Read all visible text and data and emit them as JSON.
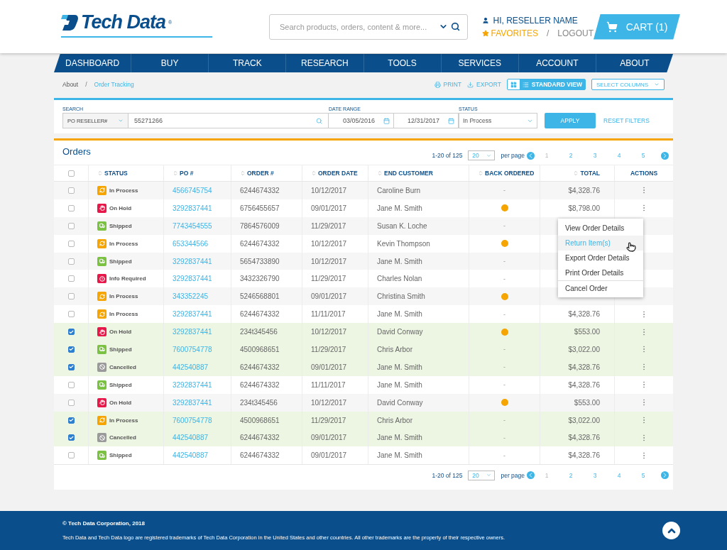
{
  "header": {
    "logo_text": "Tech Data",
    "logo_mark": "®",
    "search": {
      "placeholder": "Search products, orders, content & more..."
    },
    "greeting": "HI, RESELLER NAME",
    "favorites": "FAVORITES",
    "separator": "/",
    "logout": "LOGOUT",
    "cart": "CART (1)"
  },
  "nav": [
    {
      "label": "DASHBOARD",
      "selected": false
    },
    {
      "label": "BUY",
      "selected": false
    },
    {
      "label": "TRACK",
      "selected": false
    },
    {
      "label": "RESEARCH",
      "selected": false
    },
    {
      "label": "TOOLS",
      "selected": false
    },
    {
      "label": "SERVICES",
      "selected": false
    },
    {
      "label": "ACCOUNT",
      "selected": false
    },
    {
      "label": "ABOUT",
      "selected": false
    }
  ],
  "breadcrumb": [
    {
      "label": "About",
      "current": false
    },
    {
      "label": "Order Tracking",
      "current": true
    }
  ],
  "breadcrumb_separator": "/",
  "toolbar": {
    "print": "PRINT",
    "export": "EXPORT",
    "views": [
      {
        "kind": "grid",
        "selected": false
      },
      {
        "kind": "list",
        "label": "STANDARD VIEW",
        "selected": true
      }
    ],
    "select_columns": "SELECT COLUMNS"
  },
  "filters": {
    "search_label": "SEARCH",
    "search_type": "PO RESELLER#",
    "search_value": "55271266",
    "date_label": "DATE RANGE",
    "date_from": "03/05/2016",
    "date_to": "12/31/2017",
    "status_label": "STATUS",
    "status_value": "In Process",
    "apply": "APPLY",
    "reset": "RESET FILTERS"
  },
  "orders": {
    "title": "Orders",
    "pagination_top": {
      "range": "1-20 of 125",
      "per_page": "20",
      "per_page_label": "per page",
      "pages": [
        {
          "label": "1",
          "selected": true
        },
        {
          "label": "2",
          "selected": false
        },
        {
          "label": "3",
          "selected": false
        },
        {
          "label": "4",
          "selected": false
        },
        {
          "label": "5",
          "selected": false
        }
      ]
    },
    "select_all_checked": false,
    "columns": [
      {
        "label": "STATUS",
        "sortable": true
      },
      {
        "label": "PO #",
        "sortable": true
      },
      {
        "label": "ORDER #",
        "sortable": true
      },
      {
        "label": "ORDER DATE",
        "sortable": true
      },
      {
        "label": "END CUSTOMER",
        "sortable": true
      },
      {
        "label": "BACK ORDERED",
        "sortable": true
      },
      {
        "label": "TOTAL",
        "sortable": true
      },
      {
        "label": "ACTIONS",
        "sortable": false
      }
    ],
    "rows": [
      {
        "checked": false,
        "status": {
          "kind": "in_process",
          "label": "In Process"
        },
        "po": "4566745754",
        "order": "6244674332",
        "date": "10/12/2017",
        "customer": "Caroline Burn",
        "back_ordered": false,
        "back_ordered_text": "-",
        "total": "$4,328.76",
        "actions": true
      },
      {
        "checked": false,
        "status": {
          "kind": "on_hold",
          "label": "On Hold"
        },
        "po": "3292837441",
        "order": "6756455657",
        "date": "09/01/2017",
        "customer": "Jane M. Smith",
        "back_ordered": true,
        "total": "$8,798.00",
        "actions": true
      },
      {
        "checked": false,
        "status": {
          "kind": "shipped",
          "label": "Shipped"
        },
        "po": "7743454555",
        "order": "7864576009",
        "date": "11/29/2017",
        "customer": "Susan K. Loche",
        "back_ordered": false,
        "back_ordered_text": "-",
        "actions": false
      },
      {
        "checked": false,
        "status": {
          "kind": "in_process",
          "label": "In Process"
        },
        "po": "653344566",
        "order": "6244674332",
        "date": "10/12/2017",
        "customer": "Kevin Thompson",
        "back_ordered": true,
        "actions": false
      },
      {
        "checked": false,
        "status": {
          "kind": "shipped",
          "label": "Shipped"
        },
        "po": "3292837441",
        "order": "5654733890",
        "date": "10/12/2017",
        "customer": "Jane M. Smith",
        "back_ordered": false,
        "back_ordered_text": "-",
        "actions": false
      },
      {
        "checked": false,
        "status": {
          "kind": "info_required",
          "label": "Info Required"
        },
        "po": "3292837441",
        "order": "3432326790",
        "date": "11/29/2017",
        "customer": "Charles Nolan",
        "back_ordered": false,
        "back_ordered_text": "-",
        "actions": false
      },
      {
        "checked": false,
        "status": {
          "kind": "in_process",
          "label": "In Process"
        },
        "po": "343352245",
        "order": "5246568801",
        "date": "09/01/2017",
        "customer": "Christina Smith",
        "back_ordered": true,
        "actions": false
      },
      {
        "checked": false,
        "status": {
          "kind": "in_process",
          "label": "In Process"
        },
        "po": "3292837441",
        "order": "6244674332",
        "date": "11/11/2017",
        "customer": "Jane M. Smith",
        "back_ordered": false,
        "back_ordered_text": "-",
        "total": "$4,328.76",
        "actions": true
      },
      {
        "checked": true,
        "status": {
          "kind": "on_hold",
          "label": "On Hold"
        },
        "po": "3292837441",
        "order": "234t345456",
        "date": "10/12/2017",
        "customer": "David Conway",
        "back_ordered": true,
        "total": "$553.00",
        "actions": true
      },
      {
        "checked": true,
        "status": {
          "kind": "shipped",
          "label": "Shipped"
        },
        "po": "7600754778",
        "order": "4500968651",
        "date": "11/29/2017",
        "customer": "Chris Arbor",
        "back_ordered": false,
        "back_ordered_text": "-",
        "total": "$3,022.00",
        "actions": true
      },
      {
        "checked": true,
        "status": {
          "kind": "cancelled",
          "label": "Cancelled"
        },
        "po": "442540887",
        "order": "6244674332",
        "date": "09/01/2017",
        "customer": "Jane M. Smith",
        "back_ordered": false,
        "back_ordered_text": "-",
        "total": "$4,328.76",
        "actions": true
      },
      {
        "checked": false,
        "status": {
          "kind": "shipped",
          "label": "Shipped"
        },
        "po": "3292837441",
        "order": "6244674332",
        "date": "11/11/2017",
        "customer": "Jane M. Smith",
        "back_ordered": false,
        "back_ordered_text": "-",
        "total": "$4,328.76",
        "actions": true
      },
      {
        "checked": false,
        "status": {
          "kind": "on_hold",
          "label": "On Hold"
        },
        "po": "3292837441",
        "order": "234t345456",
        "date": "10/12/2017",
        "customer": "David Conway",
        "back_ordered": true,
        "total": "$553.00",
        "actions": true
      },
      {
        "checked": true,
        "status": {
          "kind": "in_process",
          "label": "In Process"
        },
        "po": "7600754778",
        "order": "4500968651",
        "date": "11/29/2017",
        "customer": "Chris Arbor",
        "back_ordered": false,
        "back_ordered_text": "-",
        "total": "$3,022.00",
        "actions": true
      },
      {
        "checked": true,
        "status": {
          "kind": "cancelled",
          "label": "Cancelled"
        },
        "po": "442540887",
        "order": "6244674332",
        "date": "09/01/2017",
        "customer": "Jane M. Smith",
        "back_ordered": false,
        "back_ordered_text": "-",
        "total": "$4,328.76",
        "actions": true
      },
      {
        "checked": false,
        "status": {
          "kind": "shipped",
          "label": "Shipped"
        },
        "po": "442540887",
        "order": "6244674332",
        "date": "09/01/2017",
        "customer": "Jane M. Smith",
        "back_ordered": false,
        "back_ordered_text": "-",
        "total": "$4,328.76",
        "actions": true
      }
    ],
    "action_menu": [
      {
        "label": "View Order Details",
        "highlighted": false,
        "divider_before": false
      },
      {
        "label": "Return Item(s)",
        "highlighted": true,
        "divider_before": false
      },
      {
        "label": "Export Order Details",
        "highlighted": false,
        "divider_before": false
      },
      {
        "label": "Print Order Details",
        "highlighted": false,
        "divider_before": false
      },
      {
        "label": "Cancel Order",
        "highlighted": false,
        "divider_before": true
      }
    ],
    "pagination_bottom": {
      "range": "1-20 of 125",
      "per_page": "20",
      "per_page_label": "per page",
      "pages": [
        {
          "label": "1",
          "selected": true
        },
        {
          "label": "2",
          "selected": false
        },
        {
          "label": "3",
          "selected": false
        },
        {
          "label": "4",
          "selected": false
        },
        {
          "label": "5",
          "selected": false
        }
      ]
    }
  },
  "footer": {
    "copyright": "© Tech Data Corporation, 2018",
    "legal": "Tech Data and Tech Data logo are registered trademarks of Tech Data Corporation in the United States and other countries. All other trademarks are the property of their respective owners."
  }
}
